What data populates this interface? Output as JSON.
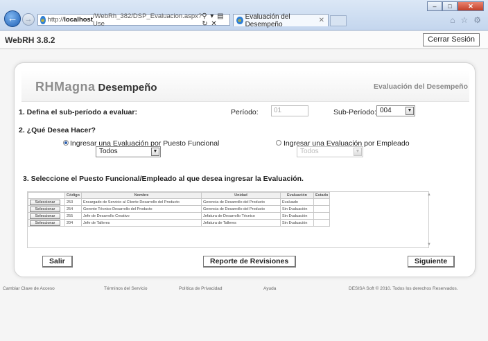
{
  "browser": {
    "url_prefix": "http://",
    "url_host": "localhost",
    "url_path": "/WebRh_382/DSP_Evaluacion.aspx?Use",
    "tab_title": "Evaluación del Desempeño"
  },
  "app": {
    "title": "WebRH 3.8.2",
    "logout_label": "Cerrar Sesión"
  },
  "panel": {
    "brand": "RHMagna",
    "module": "Desempeño",
    "page_title": "Evaluación del Desempeño"
  },
  "step1": {
    "label": "1. Defina el sub-período a evaluar:",
    "periodo_label": "Período:",
    "periodo_value": "01",
    "subperiodo_label": "Sub-Período:",
    "subperiodo_value": "004"
  },
  "step2": {
    "label": "2. ¿Qué Desea Hacer?",
    "option_puesto": "Ingresar una Evaluación por Puesto Funcional",
    "option_empleado": "Ingresar una Evaluación por Empleado",
    "puesto_filter": "Todos",
    "empleado_filter": "Todos",
    "selected": "puesto"
  },
  "step3": {
    "label": "3. Seleccione el Puesto Funcional/Empleado al que desea ingresar la Evaluación."
  },
  "grid": {
    "columns": [
      "Código",
      "Nombre",
      "Unidad",
      "Evaluación",
      "Estado"
    ],
    "select_label": "Seleccionar",
    "rows": [
      {
        "codigo": "253",
        "nombre": "Encargado de Servicio al Cliente Desarrollo del Producto",
        "unidad": "Gerencia de Desarrollo del Producto",
        "evaluacion": "Evaluado",
        "estado": ""
      },
      {
        "codigo": "254",
        "nombre": "Gerente Técnico Desarrollo del Producto",
        "unidad": "Gerencia de Desarrollo del Producto",
        "evaluacion": "Sin Evaluación",
        "estado": ""
      },
      {
        "codigo": "255",
        "nombre": "Jefe de Desarrollo Creativo",
        "unidad": "Jefatura de Desarrollo Técnico",
        "evaluacion": "Sin Evaluación",
        "estado": ""
      },
      {
        "codigo": "204",
        "nombre": "Jefe de Talleres",
        "unidad": "Jefatura de Talleres",
        "evaluacion": "Sin Evaluación",
        "estado": ""
      }
    ]
  },
  "actions": {
    "salir": "Salir",
    "reporte": "Reporte de Revisiones",
    "siguiente": "Siguiente"
  },
  "footer": {
    "cambiar_clave": "Cambiar Clave de Acceso",
    "terminos": "Términos del Servicio",
    "privacidad": "Política de Privacidad",
    "ayuda": "Ayuda",
    "copyright": "DESISA Soft © 2010. Todos los derechos Reservados."
  }
}
